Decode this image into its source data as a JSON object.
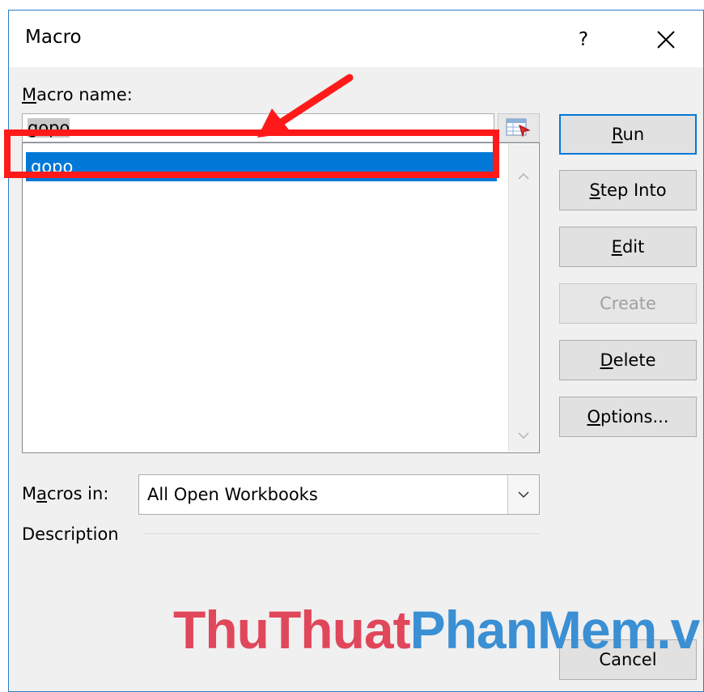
{
  "window": {
    "title": "Macro",
    "help_label": "?"
  },
  "macro_name": {
    "label_underline": "M",
    "label_rest": "acro name:",
    "value": "gopo",
    "list_items": [
      "gopo"
    ]
  },
  "buttons": {
    "run": {
      "ul": "R",
      "rest": "un"
    },
    "step_into": {
      "ul": "S",
      "rest": "tep Into"
    },
    "edit": {
      "ul": "E",
      "rest": "dit"
    },
    "create": {
      "ul": "",
      "rest": "Create"
    },
    "delete": {
      "ul": "D",
      "rest": "elete"
    },
    "options": {
      "ul": "O",
      "rest": "ptions..."
    },
    "cancel": {
      "ul": "",
      "rest": "Cancel"
    }
  },
  "macros_in": {
    "label_pre": "M",
    "label_ul": "a",
    "label_post": "cros in:",
    "selected": "All Open Workbooks"
  },
  "description": {
    "label": "Description"
  },
  "watermark": {
    "part1": "ThuThuat",
    "part2": "PhanMem.vn"
  },
  "colors": {
    "selection": "#0078d7",
    "annotation": "#ff1a1a",
    "watermark_red": "#e0475b",
    "watermark_blue": "#3b8fd3"
  }
}
